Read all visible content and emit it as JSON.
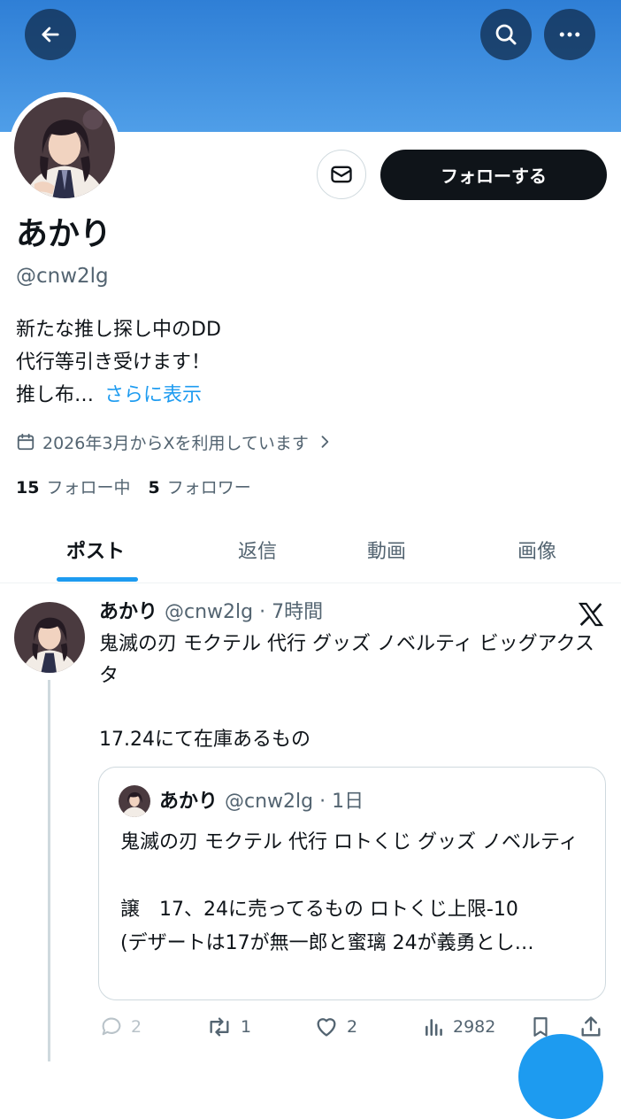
{
  "colors": {
    "banner": "#3b8be0",
    "accent": "#1d9bf0",
    "text_primary": "#0f1419",
    "text_secondary": "#536471",
    "follow_button": "#0f1419",
    "border": "#cfd9de"
  },
  "header": {
    "back_icon": "arrow-left-icon",
    "search_icon": "search-icon",
    "more_icon": "more-horizontal-icon"
  },
  "profile": {
    "display_name": "あかり",
    "handle": "@cnw2lg",
    "follow_label": "フォローする",
    "message_icon": "mail-icon",
    "bio_lines": [
      "新たな推し探し中のDD",
      "代行等引き受けます！",
      "推し布…"
    ],
    "bio_more": "さらに表示",
    "joined": "2026年3月からXを利用しています",
    "following_count": "15",
    "following_label": "フォロー中",
    "followers_count": "5",
    "followers_label": "フォロワー"
  },
  "tabs": [
    {
      "label": "ポスト",
      "active": true
    },
    {
      "label": "返信",
      "active": false
    },
    {
      "label": "動画",
      "active": false
    },
    {
      "label": "画像",
      "active": false
    }
  ],
  "post": {
    "author": "あかり",
    "meta": "@cnw2lg · 7時間",
    "text": "鬼滅の刃 モクテル 代行 グッズ ノベルティ ビッグアクスタ\n\n17.24にて在庫あるもの",
    "quote": {
      "author": "あかり",
      "meta": "@cnw2lg · 1日",
      "text": "鬼滅の刃 モクテル 代行 ロトくじ グッズ ノベルティ\n\n譲　17、24に売ってるもの ロトくじ上限-10\n(デザートは17が無一郎と蜜璃 24が義勇とし…"
    },
    "actions": {
      "replies": "2",
      "reposts": "1",
      "likes": "2",
      "views": "2982"
    }
  }
}
